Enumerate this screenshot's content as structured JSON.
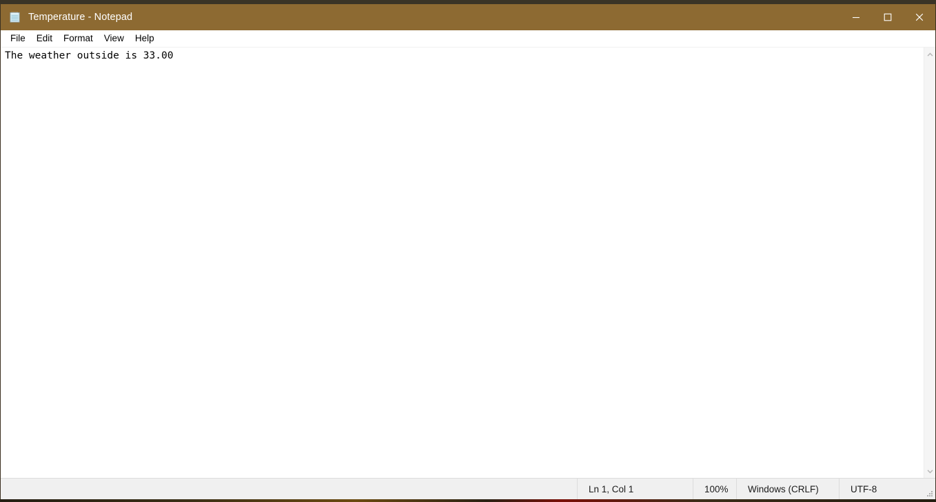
{
  "window": {
    "title": "Temperature - Notepad",
    "icon": "notepad-icon",
    "titlebar_color": "#8d6a32",
    "controls": [
      {
        "name": "minimize",
        "glyph": "minimize-icon"
      },
      {
        "name": "maximize",
        "glyph": "maximize-icon"
      },
      {
        "name": "close",
        "glyph": "close-icon"
      }
    ]
  },
  "menubar": {
    "items": [
      {
        "label": "File"
      },
      {
        "label": "Edit"
      },
      {
        "label": "Format"
      },
      {
        "label": "View"
      },
      {
        "label": "Help"
      }
    ]
  },
  "editor": {
    "content": "The weather outside is 33.00",
    "placeholder": ""
  },
  "scrollbar": {
    "up_arrow": "chevron-up-icon",
    "down_arrow": "chevron-down-icon"
  },
  "statusbar": {
    "line_col": "Ln 1, Col 1",
    "zoom": "100%",
    "line_ending": "Windows (CRLF)",
    "encoding": "UTF-8",
    "grip": "resize-grip-icon"
  }
}
